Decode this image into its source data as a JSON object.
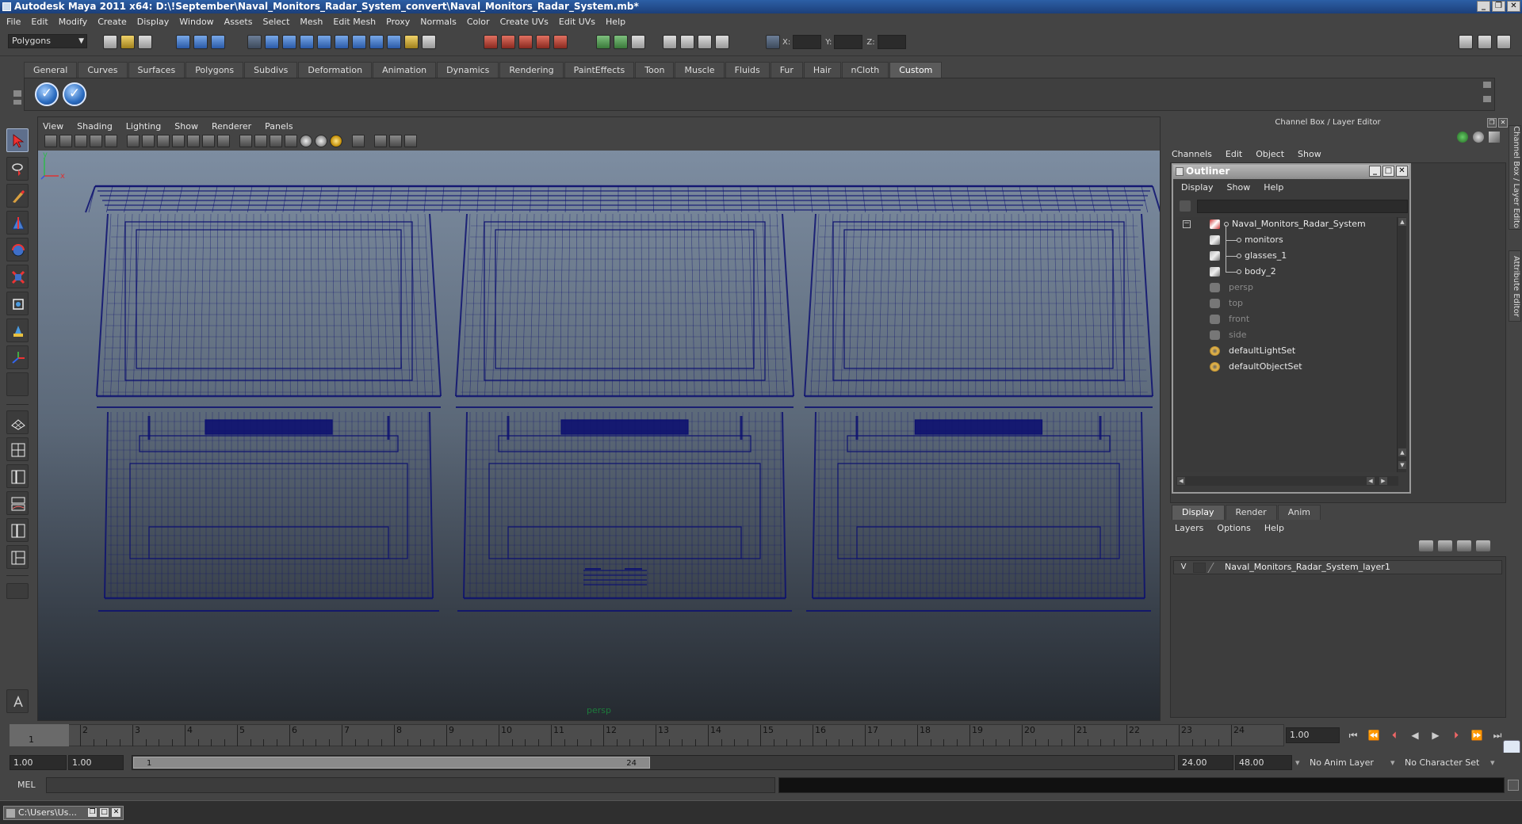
{
  "window": {
    "title": "Autodesk Maya 2011 x64: D:\\!September\\Naval_Monitors_Radar_System_convert\\Naval_Monitors_Radar_System.mb*",
    "minimize_icon": "minimize-icon",
    "restore_icon": "restore-icon",
    "close_icon": "close-icon"
  },
  "menubar": {
    "items": [
      "File",
      "Edit",
      "Modify",
      "Create",
      "Display",
      "Window",
      "Assets",
      "Select",
      "Mesh",
      "Edit Mesh",
      "Proxy",
      "Normals",
      "Color",
      "Create UVs",
      "Edit UVs",
      "Help"
    ]
  },
  "statusline": {
    "mode": "Polygons",
    "x_label": "X:",
    "y_label": "Y:",
    "z_label": "Z:"
  },
  "shelf": {
    "tabs": [
      "General",
      "Curves",
      "Surfaces",
      "Polygons",
      "Subdivs",
      "Deformation",
      "Animation",
      "Dynamics",
      "Rendering",
      "PaintEffects",
      "Toon",
      "Muscle",
      "Fluids",
      "Fur",
      "Hair",
      "nCloth",
      "Custom"
    ],
    "active_tab": "Custom",
    "buttons": [
      "checkmark-icon",
      "checkmark-icon"
    ]
  },
  "viewport": {
    "menu": [
      "View",
      "Shading",
      "Lighting",
      "Show",
      "Renderer",
      "Panels"
    ],
    "camera_label": "persp",
    "axis_y": "y",
    "axis_x": "x",
    "wire_color": "#0d1170"
  },
  "channel_box": {
    "header": "Channel Box / Layer Editor",
    "menu": [
      "Channels",
      "Edit",
      "Object",
      "Show"
    ]
  },
  "outliner": {
    "title": "Outliner",
    "menu": [
      "Display",
      "Show",
      "Help"
    ],
    "items": [
      {
        "label": "Naval_Monitors_Radar_System",
        "icon": "group-icon",
        "level": 0,
        "style": "bright"
      },
      {
        "label": "monitors",
        "icon": "mesh-icon",
        "level": 1,
        "style": "bright"
      },
      {
        "label": "glasses_1",
        "icon": "mesh-icon",
        "level": 1,
        "style": "bright"
      },
      {
        "label": "body_2",
        "icon": "mesh-icon",
        "level": 1,
        "style": "bright"
      },
      {
        "label": "persp",
        "icon": "camera-icon",
        "level": 0,
        "style": "dim"
      },
      {
        "label": "top",
        "icon": "camera-icon",
        "level": 0,
        "style": "dim"
      },
      {
        "label": "front",
        "icon": "camera-icon",
        "level": 0,
        "style": "dim"
      },
      {
        "label": "side",
        "icon": "camera-icon",
        "level": 0,
        "style": "dim"
      },
      {
        "label": "defaultLightSet",
        "icon": "set-icon",
        "level": 0,
        "style": "bright"
      },
      {
        "label": "defaultObjectSet",
        "icon": "set-icon",
        "level": 0,
        "style": "bright"
      }
    ]
  },
  "layer_editor": {
    "tabs": [
      "Display",
      "Render",
      "Anim"
    ],
    "active_tab": "Display",
    "menu": [
      "Layers",
      "Options",
      "Help"
    ],
    "layer": {
      "visible": "V",
      "name": "Naval_Monitors_Radar_System_layer1"
    }
  },
  "side_tabs": [
    "Channel Box / Layer Editor",
    "Attribute Editor"
  ],
  "timeline": {
    "ticks": [
      "1",
      "2",
      "3",
      "4",
      "5",
      "6",
      "7",
      "8",
      "9",
      "10",
      "11",
      "12",
      "13",
      "14",
      "15",
      "16",
      "17",
      "18",
      "19",
      "20",
      "21",
      "22",
      "23",
      "24"
    ],
    "current_marker": "1",
    "current_frame": "1.00"
  },
  "range": {
    "start": "1.00",
    "playback_start": "1.00",
    "handle_start": "1",
    "handle_end": "24",
    "playback_end": "24.00",
    "end": "48.00",
    "anim_layer": "No Anim Layer",
    "character_set": "No Character Set"
  },
  "command_line": {
    "label": "MEL"
  },
  "taskbar": {
    "label": "C:\\Users\\Us..."
  }
}
